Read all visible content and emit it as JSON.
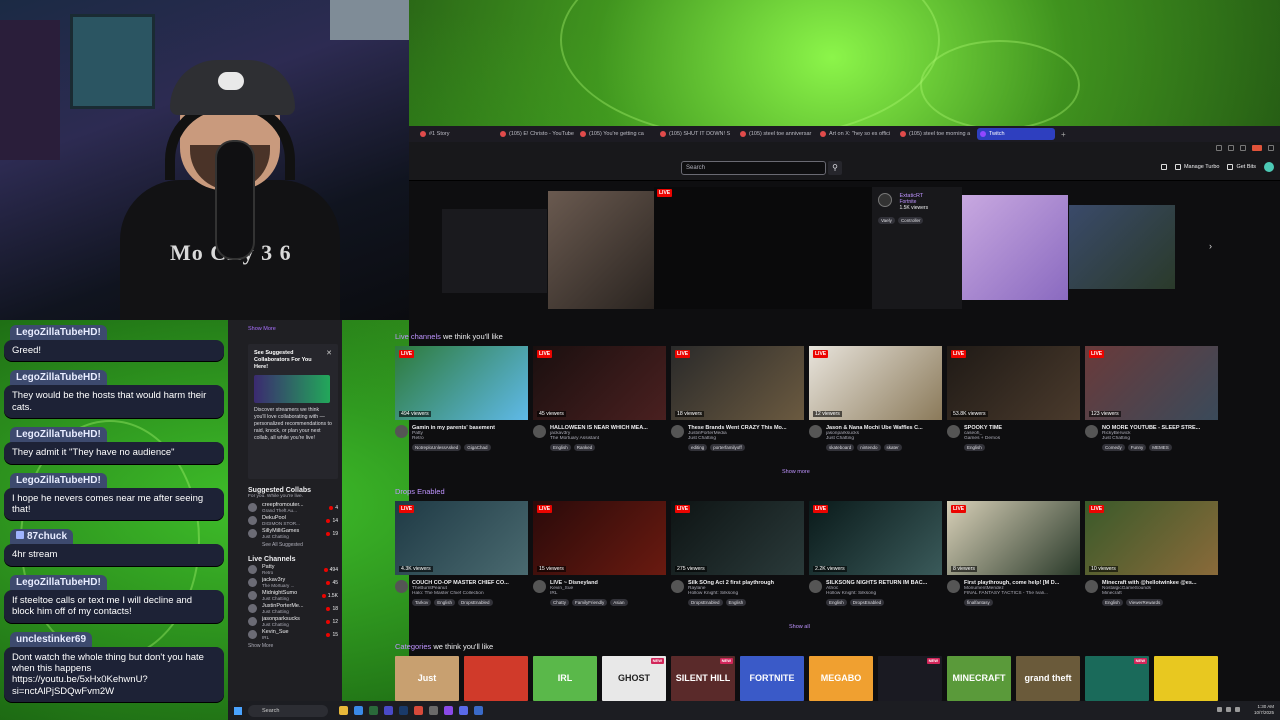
{
  "chat": [
    {
      "user": "LegoZillaTubeHD!",
      "text": "Greed!",
      "badge": false
    },
    {
      "user": "LegoZillaTubeHD!",
      "text": "They would be the hosts that would harm their cats.",
      "badge": false
    },
    {
      "user": "LegoZillaTubeHD!",
      "text": "They admit it \"They have no audience\"",
      "badge": false
    },
    {
      "user": "LegoZillaTubeHD!",
      "text": "I hope he nevers comes near me after seeing that!",
      "badge": false
    },
    {
      "user": "87chuck",
      "text": "4hr stream",
      "badge": true
    },
    {
      "user": "LegoZillaTubeHD!",
      "text": "If steeltoe calls or text me I will decline and block him off of my contacts!",
      "badge": false
    },
    {
      "user": "unclestinker69",
      "text": "Dont watch the whole thing but don't you hate when this happens https://youtu.be/5xHx0KehwnU?si=nctAlPjSDQwFvm2W",
      "badge": false
    }
  ],
  "webcam": {
    "shirt_text": "Mo City 3 6"
  },
  "browser": {
    "tabs": [
      {
        "label": "#1 Story",
        "active": false
      },
      {
        "label": "(105) E! Christo - YouTube",
        "active": false
      },
      {
        "label": "(105) You're getting ca",
        "active": false
      },
      {
        "label": "(105) SHUT IT DOWN! S",
        "active": false
      },
      {
        "label": "(105) steel toe anniversar",
        "active": false
      },
      {
        "label": "Art on X: \"hey so es offici",
        "active": false
      },
      {
        "label": "(105) steel toe morning a",
        "active": false
      },
      {
        "label": "Twitch",
        "active": true
      }
    ]
  },
  "nav": {
    "search_placeholder": "Search",
    "search_icon": "magnifier-icon",
    "manage_turbo": "Manage Turbo",
    "get_bits": "Get Bits"
  },
  "sidebar": {
    "show_more": "Show More",
    "suggest_title": "See Suggested Collaborators For You Here!",
    "suggest_body": "Discover streamers we think you'll love collaborating with — personalized recommendations to raid, knock, or plan your next collab, all while you're live!",
    "collabs_title": "Suggested Collabs",
    "collabs_sub": "For you. While you're live.",
    "collabs": [
      {
        "name": "creepfromouter...",
        "sub": "Grand Theft Au...",
        "count": "4"
      },
      {
        "name": "DekuPool",
        "sub": "DIGIMON STOR...",
        "count": "14"
      },
      {
        "name": "SillyMilliGames",
        "sub": "Just Chatting",
        "count": "19"
      }
    ],
    "see_all": "See All Suggested",
    "live_title": "Live Channels",
    "live": [
      {
        "name": "Patty",
        "sub": "Retro",
        "count": "494"
      },
      {
        "name": "jackav3ry",
        "sub": "The Mortuary ...",
        "count": "45"
      },
      {
        "name": "MidnightSumo",
        "sub": "Just Chatting",
        "count": "1.5K"
      },
      {
        "name": "JustinPorterMe...",
        "sub": "Just Chatting",
        "count": "18"
      },
      {
        "name": "jasonparksucks",
        "sub": "Just Chatting",
        "count": "12"
      },
      {
        "name": "Kevin_Sue",
        "sub": "IRL",
        "count": "15"
      }
    ],
    "show_more_bottom": "Show More"
  },
  "carousel": {
    "live": "LIVE",
    "channel": "ExtaticRT",
    "game": "Fortnite",
    "viewers": "1.5K viewers",
    "tags": [
      "Vaely",
      "Controller"
    ]
  },
  "live_section": {
    "title_hl": "Live channels",
    "title_rest": " we think you'll like",
    "cards": [
      {
        "views": "494 viewers",
        "title": "Gamin in my parents' basement",
        "channel": "Patty",
        "game": "Retro",
        "tags": [
          "NotreploUnlessAsked",
          "GigaChad"
        ],
        "c1": "#2d7a3a",
        "c2": "#5fb9e8"
      },
      {
        "views": "45 viewers",
        "title": "HALLOWEEN IS NEAR WHICH MEA...",
        "channel": "jackav3ry",
        "game": "The Mortuary Assistant",
        "tags": [
          "English",
          "Ranked"
        ],
        "c1": "#1a0f0f",
        "c2": "#4a2020"
      },
      {
        "views": "18 viewers",
        "title": "These Brands Went CRAZY This Mo...",
        "channel": "JustinPorterMedia",
        "game": "Just Chatting",
        "tags": [
          "editing",
          "porterfamilyoff"
        ],
        "c1": "#2a2a2a",
        "c2": "#6b5a40"
      },
      {
        "views": "12 viewers",
        "title": "Jason & Nana Mochi Ube Waffles C...",
        "channel": "jasonparksucks",
        "game": "Just Chatting",
        "tags": [
          "skateboard",
          "nintendo",
          "skater"
        ],
        "c1": "#e8e4dc",
        "c2": "#8b7a5a"
      },
      {
        "views": "53.8K viewers",
        "title": "SPOOKY TIME",
        "channel": "caseoh_",
        "game": "Games + Demos",
        "tags": [
          "English"
        ],
        "c1": "#1f1a16",
        "c2": "#4a3a2c"
      },
      {
        "views": "123 viewers",
        "title": "NO MORE YOUTUBE - SLEEP STRE...",
        "channel": "RickyBerwick",
        "game": "Just Chatting",
        "tags": [
          "Comedy",
          "Funny",
          "MEMES"
        ],
        "c1": "#6a3a3a",
        "c2": "#3a4a5a"
      }
    ],
    "show_more": "Show more"
  },
  "drops_section": {
    "title_hl": "Drops Enabled",
    "cards": [
      {
        "views": "4.3K viewers",
        "title": "COUCH CO-OP MASTER CHIEF CO...",
        "channel": "TheBurntPeanut",
        "game": "Halo: The Master Chief Collection",
        "tags": [
          "Tarkov",
          "English",
          "DropsEnabled"
        ],
        "c1": "#1f3a45",
        "c2": "#4a6a70"
      },
      {
        "views": "15 viewers",
        "title": "LIVE ~ Disneyland",
        "channel": "Kevin_Sue",
        "game": "IRL",
        "tags": [
          "Chatty",
          "FamilyFriendly",
          "Asian"
        ],
        "c1": "#2a0a0a",
        "c2": "#6a1a10"
      },
      {
        "views": "275 viewers",
        "title": "Silk SOng Act 2 first playthrough",
        "channel": "Raylane",
        "game": "Hollow Knight: Silksong",
        "tags": [
          "DropsEnabled",
          "English"
        ],
        "c1": "#0e1414",
        "c2": "#2a3a3a"
      },
      {
        "views": "2.2K viewers",
        "title": "SILKSONG NIGHTS RETURN IM BAC...",
        "channel": "Atrioc",
        "game": "Hollow Knight: Silksong",
        "tags": [
          "English",
          "DropsEnabled"
        ],
        "c1": "#0a1a1a",
        "c2": "#3a5a5a"
      },
      {
        "views": "8 viewers",
        "title": "First playthrough, come help! [M D...",
        "channel": "MonumentMendez",
        "game": "FINAL FANTASY TACTICS - The Ivali...",
        "tags": [
          "finalfantasy"
        ],
        "c1": "#d8d0b8",
        "c2": "#2a3a2a"
      },
      {
        "views": "10 viewers",
        "title": "Minecraft with @hellotwinkee @es...",
        "channel": "NostalgicGameSounds",
        "game": "Minecraft",
        "tags": [
          "English",
          "ViewerRewards"
        ],
        "c1": "#3a5a2a",
        "c2": "#8a6a3a"
      }
    ],
    "show_all": "Show all"
  },
  "categories": {
    "title_hl": "Categories",
    "title_rest": " we think you'll like",
    "items": [
      {
        "label": "Just",
        "bg": "#c8a070",
        "new": false
      },
      {
        "label": "",
        "bg": "#d03a2a",
        "new": false
      },
      {
        "label": "IRL",
        "bg": "#5ab84a",
        "new": false
      },
      {
        "label": "GHOST",
        "bg": "#e8e8e8",
        "new": true
      },
      {
        "label": "SILENT HILL",
        "bg": "#5a2a2a",
        "new": true
      },
      {
        "label": "FORTNITE",
        "bg": "#3a5ac8",
        "new": false
      },
      {
        "label": "MEGABO",
        "bg": "#f0a030",
        "new": false
      },
      {
        "label": "",
        "bg": "#1a1a22",
        "new": true
      },
      {
        "label": "MINECRAFT",
        "bg": "#5a9a3a",
        "new": false
      },
      {
        "label": "grand theft",
        "bg": "#6a5a3a",
        "new": false
      },
      {
        "label": "",
        "bg": "#1a6a5a",
        "new": true
      },
      {
        "label": "",
        "bg": "#e8c820",
        "new": false
      }
    ]
  },
  "taskbar": {
    "search": "Search",
    "time": "1:30 AM",
    "date": "10/7/2025"
  }
}
